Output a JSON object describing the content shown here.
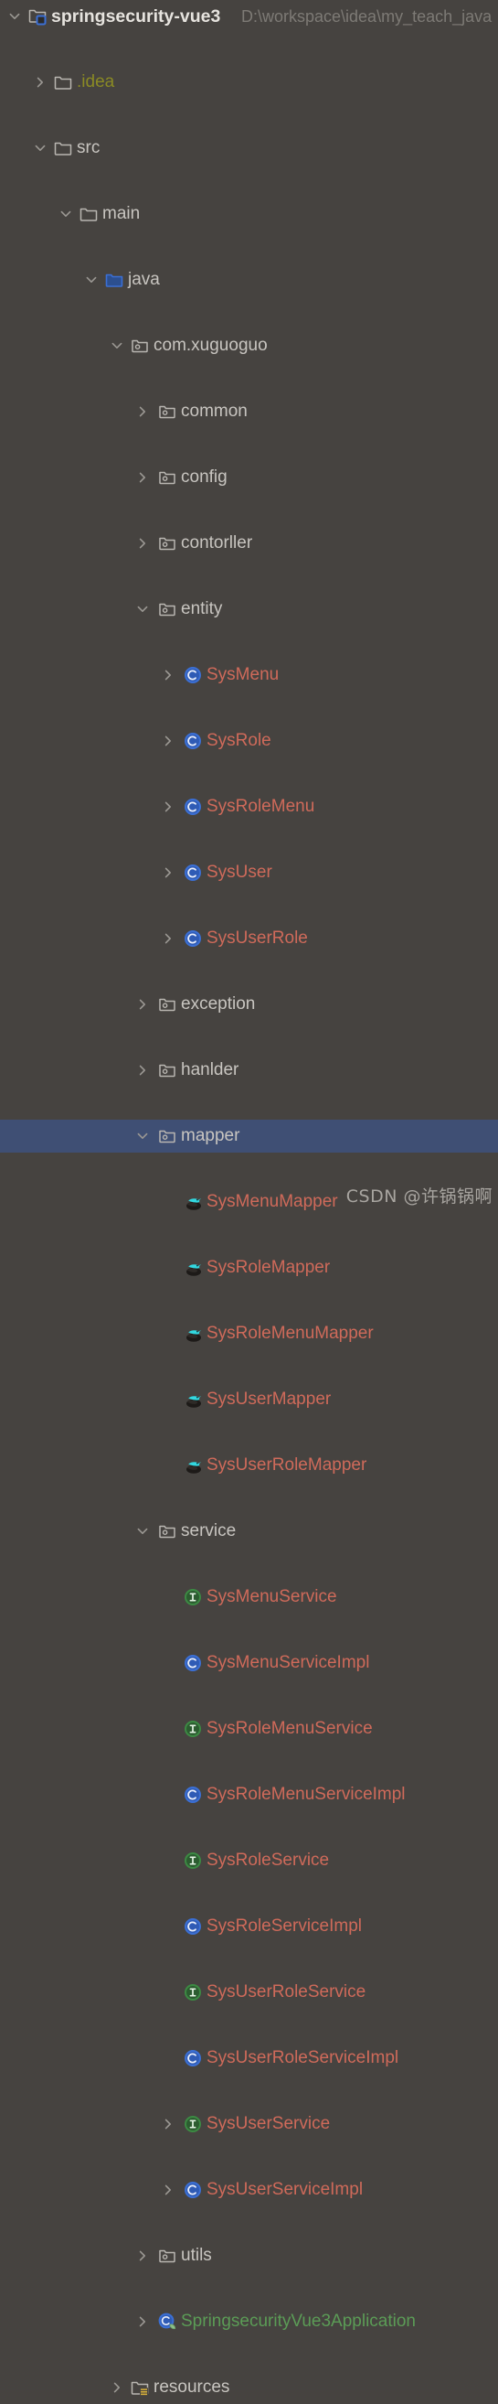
{
  "window": {
    "background_color": "#464340",
    "selection_color": "#3f4f74",
    "default_text_color": "#c8c5c0"
  },
  "project": {
    "name": "springsecurity-vue3",
    "path": "D:\\workspace\\idea\\my_teach_java"
  },
  "watermark": "CSDN @许锅锅啊",
  "colors": {
    "class_red": "#cf6a5a",
    "spring_green": "#5b9c56",
    "idea_olive": "#8a8a24",
    "class_icon_blue": "#3b6fd4",
    "interface_icon_green": "#3c8a43",
    "source_folder_blue": "#3b6fd4",
    "resources_badge_yellow": "#d8b13a",
    "mybatis_cyan": "#32d8e0"
  },
  "tree": [
    {
      "label": "springsecurity-vue3",
      "icon": "module-folder-icon",
      "depth": 0,
      "arrow": "expanded",
      "style": "root",
      "trailing_path": "D:\\workspace\\idea\\my_teach_java"
    },
    {
      "label": ".idea",
      "icon": "folder-icon",
      "depth": 1,
      "arrow": "collapsed",
      "style": "idea"
    },
    {
      "label": "src",
      "icon": "folder-icon",
      "depth": 1,
      "arrow": "expanded",
      "style": "plain"
    },
    {
      "label": "main",
      "icon": "folder-icon",
      "depth": 2,
      "arrow": "expanded",
      "style": "plain"
    },
    {
      "label": "java",
      "icon": "source-folder-icon",
      "depth": 3,
      "arrow": "expanded",
      "style": "plain"
    },
    {
      "label": "com.xuguoguo",
      "icon": "package-icon",
      "depth": 4,
      "arrow": "expanded",
      "style": "plain"
    },
    {
      "label": "common",
      "icon": "package-icon",
      "depth": 5,
      "arrow": "collapsed",
      "style": "plain"
    },
    {
      "label": "config",
      "icon": "package-icon",
      "depth": 5,
      "arrow": "collapsed",
      "style": "plain"
    },
    {
      "label": "contorller",
      "icon": "package-icon",
      "depth": 5,
      "arrow": "collapsed",
      "style": "plain"
    },
    {
      "label": "entity",
      "icon": "package-icon",
      "depth": 5,
      "arrow": "expanded",
      "style": "plain"
    },
    {
      "label": "SysMenu",
      "icon": "class-icon",
      "depth": 6,
      "arrow": "collapsed",
      "style": "red"
    },
    {
      "label": "SysRole",
      "icon": "class-icon",
      "depth": 6,
      "arrow": "collapsed",
      "style": "red"
    },
    {
      "label": "SysRoleMenu",
      "icon": "class-icon",
      "depth": 6,
      "arrow": "collapsed",
      "style": "red"
    },
    {
      "label": "SysUser",
      "icon": "class-icon",
      "depth": 6,
      "arrow": "collapsed",
      "style": "red"
    },
    {
      "label": "SysUserRole",
      "icon": "class-icon",
      "depth": 6,
      "arrow": "collapsed",
      "style": "red"
    },
    {
      "label": "exception",
      "icon": "package-icon",
      "depth": 5,
      "arrow": "collapsed",
      "style": "plain"
    },
    {
      "label": "hanlder",
      "icon": "package-icon",
      "depth": 5,
      "arrow": "collapsed",
      "style": "plain"
    },
    {
      "label": "mapper",
      "icon": "package-icon",
      "depth": 5,
      "arrow": "expanded",
      "style": "plain",
      "selected": true
    },
    {
      "label": "SysMenuMapper",
      "icon": "mybatis-icon",
      "depth": 6,
      "arrow": "none",
      "style": "red"
    },
    {
      "label": "SysRoleMapper",
      "icon": "mybatis-icon",
      "depth": 6,
      "arrow": "none",
      "style": "red"
    },
    {
      "label": "SysRoleMenuMapper",
      "icon": "mybatis-icon",
      "depth": 6,
      "arrow": "none",
      "style": "red"
    },
    {
      "label": "SysUserMapper",
      "icon": "mybatis-icon",
      "depth": 6,
      "arrow": "none",
      "style": "red"
    },
    {
      "label": "SysUserRoleMapper",
      "icon": "mybatis-icon",
      "depth": 6,
      "arrow": "none",
      "style": "red"
    },
    {
      "label": "service",
      "icon": "package-icon",
      "depth": 5,
      "arrow": "expanded",
      "style": "plain"
    },
    {
      "label": "SysMenuService",
      "icon": "interface-icon",
      "depth": 6,
      "arrow": "none",
      "style": "red"
    },
    {
      "label": "SysMenuServiceImpl",
      "icon": "class-icon",
      "depth": 6,
      "arrow": "none",
      "style": "red"
    },
    {
      "label": "SysRoleMenuService",
      "icon": "interface-icon",
      "depth": 6,
      "arrow": "none",
      "style": "red"
    },
    {
      "label": "SysRoleMenuServiceImpl",
      "icon": "class-icon",
      "depth": 6,
      "arrow": "none",
      "style": "red"
    },
    {
      "label": "SysRoleService",
      "icon": "interface-icon",
      "depth": 6,
      "arrow": "none",
      "style": "red"
    },
    {
      "label": "SysRoleServiceImpl",
      "icon": "class-icon",
      "depth": 6,
      "arrow": "none",
      "style": "red"
    },
    {
      "label": "SysUserRoleService",
      "icon": "interface-icon",
      "depth": 6,
      "arrow": "none",
      "style": "red"
    },
    {
      "label": "SysUserRoleServiceImpl",
      "icon": "class-icon",
      "depth": 6,
      "arrow": "none",
      "style": "red"
    },
    {
      "label": "SysUserService",
      "icon": "interface-icon",
      "depth": 6,
      "arrow": "collapsed",
      "style": "red"
    },
    {
      "label": "SysUserServiceImpl",
      "icon": "class-icon",
      "depth": 6,
      "arrow": "collapsed",
      "style": "red"
    },
    {
      "label": "utils",
      "icon": "package-icon",
      "depth": 5,
      "arrow": "collapsed",
      "style": "plain"
    },
    {
      "label": "SpringsecurityVue3Application",
      "icon": "spring-class-icon",
      "depth": 5,
      "arrow": "collapsed",
      "style": "green"
    },
    {
      "label": "resources",
      "icon": "resources-folder-icon",
      "depth": 4,
      "arrow": "collapsed",
      "style": "plain"
    }
  ]
}
